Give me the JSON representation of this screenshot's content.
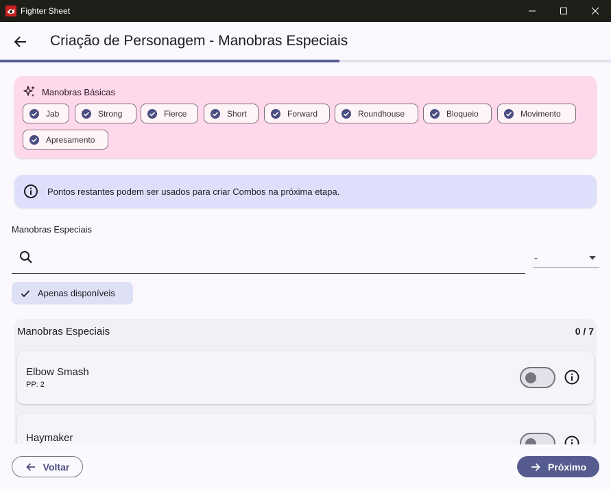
{
  "window": {
    "title": "Fighter Sheet"
  },
  "header": {
    "title": "Criação de Personagem - Manobras Especiais"
  },
  "progress": {
    "fraction": 0.555
  },
  "basic": {
    "label": "Manobras Básicas",
    "chips": [
      "Jab",
      "Strong",
      "Fierce",
      "Short",
      "Forward",
      "Roundhouse",
      "Bloqueio",
      "Movimento",
      "Apresamento"
    ]
  },
  "info": {
    "text": "Pontos restantes podem ser usados para criar Combos na próxima etapa."
  },
  "special": {
    "section_label": "Manobras Especiais",
    "search_placeholder": "",
    "filter_value": "-",
    "available_only": "Apenas disponíveis"
  },
  "list": {
    "title": "Manobras Especiais",
    "count": "0 / 7",
    "items": [
      {
        "name": "Elbow Smash",
        "pp": "PP: 2",
        "enabled": false
      },
      {
        "name": "Haymaker",
        "pp": "",
        "enabled": false
      }
    ]
  },
  "nav": {
    "back_label": "Voltar",
    "next_label": "Próximo"
  },
  "colors": {
    "accent": "#565b8f",
    "basic_card_bg": "#ffd8ec",
    "info_bg": "#dee0fb"
  }
}
